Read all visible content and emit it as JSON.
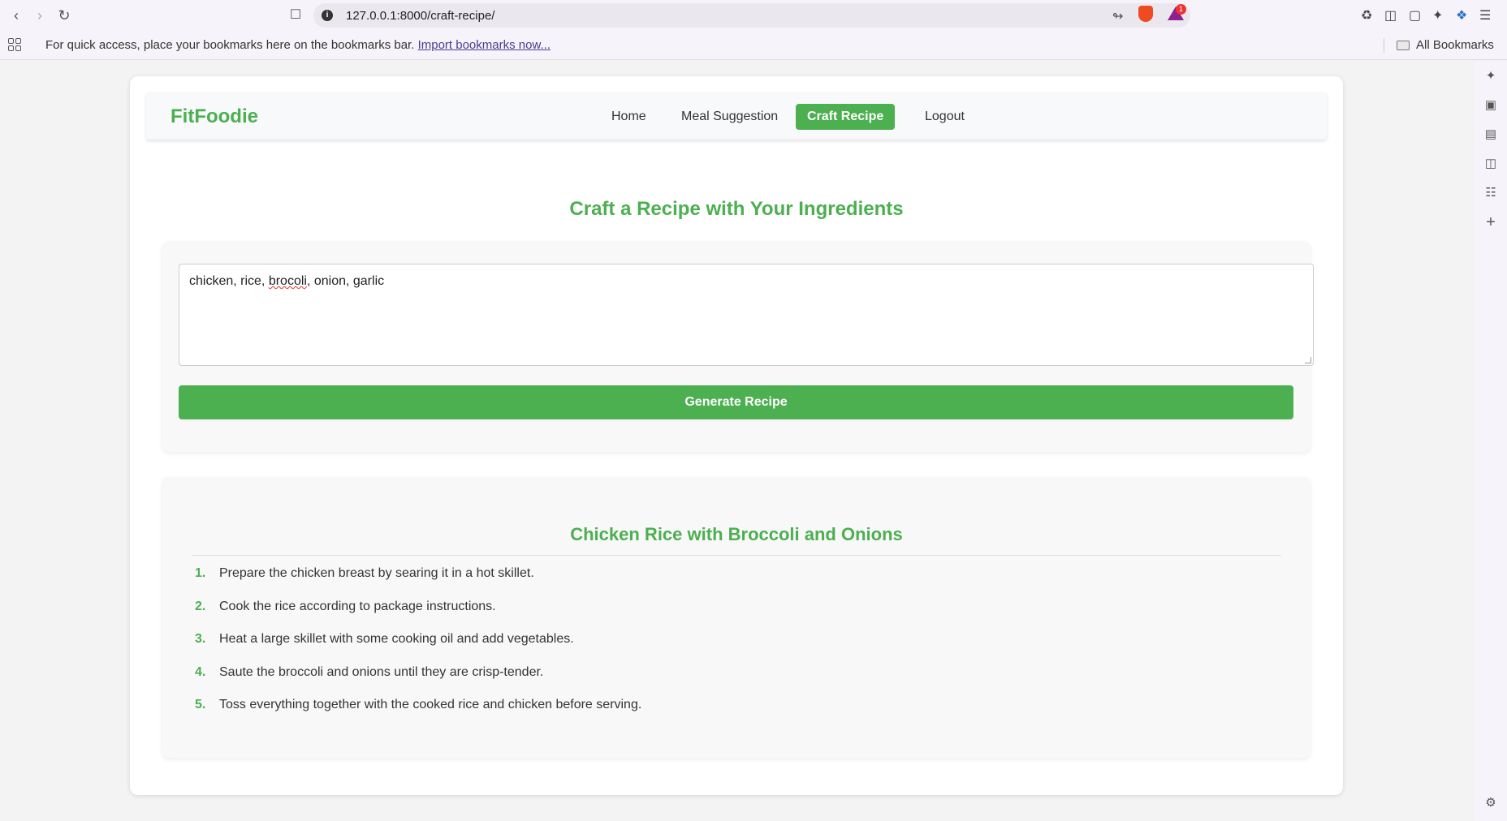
{
  "browser": {
    "url": "127.0.0.1:8000/craft-recipe/",
    "bookmarks_prompt": "For quick access, place your bookmarks here on the bookmarks bar.",
    "import_link": "Import bookmarks now...",
    "all_bookmarks": "All Bookmarks",
    "rewards_badge": "1"
  },
  "navbar": {
    "brand": "FitFoodie",
    "links": [
      "Home",
      "Meal Suggestion",
      "Craft Recipe",
      "Logout"
    ],
    "active": "Craft Recipe"
  },
  "page": {
    "title": "Craft a Recipe with Your Ingredients"
  },
  "form": {
    "ingredients_before": "chicken, rice, ",
    "ingredients_misspelled": "brocoli",
    "ingredients_after": ", onion, garlic",
    "generate_label": "Generate Recipe"
  },
  "recipe": {
    "title": "Chicken Rice with Broccoli and Onions",
    "steps": [
      {
        "num": "1.",
        "text": "Prepare the chicken breast by searing it in a hot skillet."
      },
      {
        "num": "2.",
        "text": "Cook the rice according to package instructions."
      },
      {
        "num": "3.",
        "text": "Heat a large skillet with some cooking oil and add vegetables."
      },
      {
        "num": "4.",
        "text": "Saute the broccoli and onions until they are crisp-tender."
      },
      {
        "num": "5.",
        "text": "Toss everything together with the cooked rice and chicken before serving."
      }
    ]
  },
  "colors": {
    "accent": "#4caf50",
    "background": "#f3f3f3"
  }
}
